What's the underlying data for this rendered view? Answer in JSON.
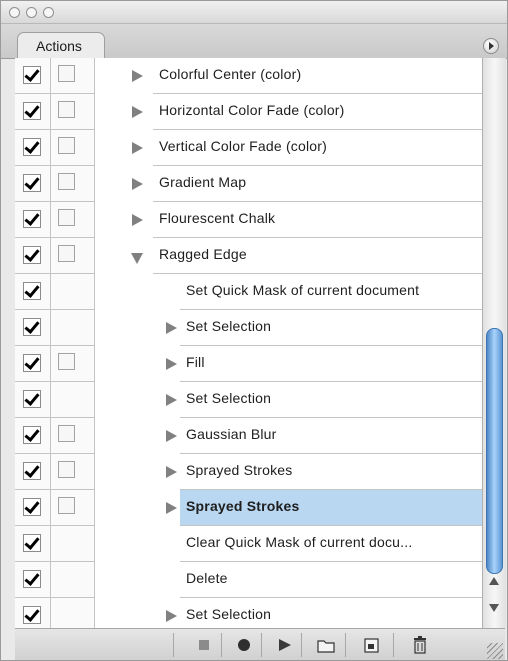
{
  "window": {
    "traffic_lights": [
      "close-button",
      "minimize-button",
      "zoom-button"
    ]
  },
  "panel": {
    "tab_label": "Actions",
    "menu_icon": "panel-menu-icon"
  },
  "rows": [
    {
      "label": "Colorful Center (color)",
      "checked": true,
      "dialog_box": true,
      "level": 0,
      "expand": "collapsed"
    },
    {
      "label": "Horizontal Color Fade (color)",
      "checked": true,
      "dialog_box": true,
      "level": 0,
      "expand": "collapsed"
    },
    {
      "label": "Vertical Color Fade (color)",
      "checked": true,
      "dialog_box": true,
      "level": 0,
      "expand": "collapsed"
    },
    {
      "label": "Gradient Map",
      "checked": true,
      "dialog_box": true,
      "level": 0,
      "expand": "collapsed"
    },
    {
      "label": "Flourescent Chalk",
      "checked": true,
      "dialog_box": true,
      "level": 0,
      "expand": "collapsed"
    },
    {
      "label": "Ragged Edge",
      "checked": true,
      "dialog_box": true,
      "level": 0,
      "expand": "expanded"
    },
    {
      "label": "Set Quick Mask of current document",
      "checked": true,
      "dialog_box": false,
      "level": 1,
      "expand": "none"
    },
    {
      "label": "Set Selection",
      "checked": true,
      "dialog_box": false,
      "level": 1,
      "expand": "collapsed"
    },
    {
      "label": "Fill",
      "checked": true,
      "dialog_box": true,
      "level": 1,
      "expand": "collapsed"
    },
    {
      "label": "Set Selection",
      "checked": true,
      "dialog_box": false,
      "level": 1,
      "expand": "collapsed"
    },
    {
      "label": "Gaussian Blur",
      "checked": true,
      "dialog_box": true,
      "level": 1,
      "expand": "collapsed"
    },
    {
      "label": "Sprayed Strokes",
      "checked": true,
      "dialog_box": true,
      "level": 1,
      "expand": "collapsed"
    },
    {
      "label": "Sprayed Strokes",
      "checked": true,
      "dialog_box": true,
      "level": 1,
      "expand": "collapsed",
      "selected": true
    },
    {
      "label": "Clear Quick Mask of current docu...",
      "checked": true,
      "dialog_box": false,
      "level": 1,
      "expand": "none"
    },
    {
      "label": "Delete",
      "checked": true,
      "dialog_box": false,
      "level": 1,
      "expand": "none"
    },
    {
      "label": "Set Selection",
      "checked": true,
      "dialog_box": false,
      "level": 1,
      "expand": "collapsed"
    }
  ],
  "toolbar": {
    "buttons": [
      "stop-icon",
      "record-icon",
      "play-icon",
      "new-set-icon",
      "new-action-icon",
      "trash-icon"
    ]
  },
  "colors": {
    "selection": "#b9d7f1",
    "scroll_thumb": "#6aa6e2"
  }
}
